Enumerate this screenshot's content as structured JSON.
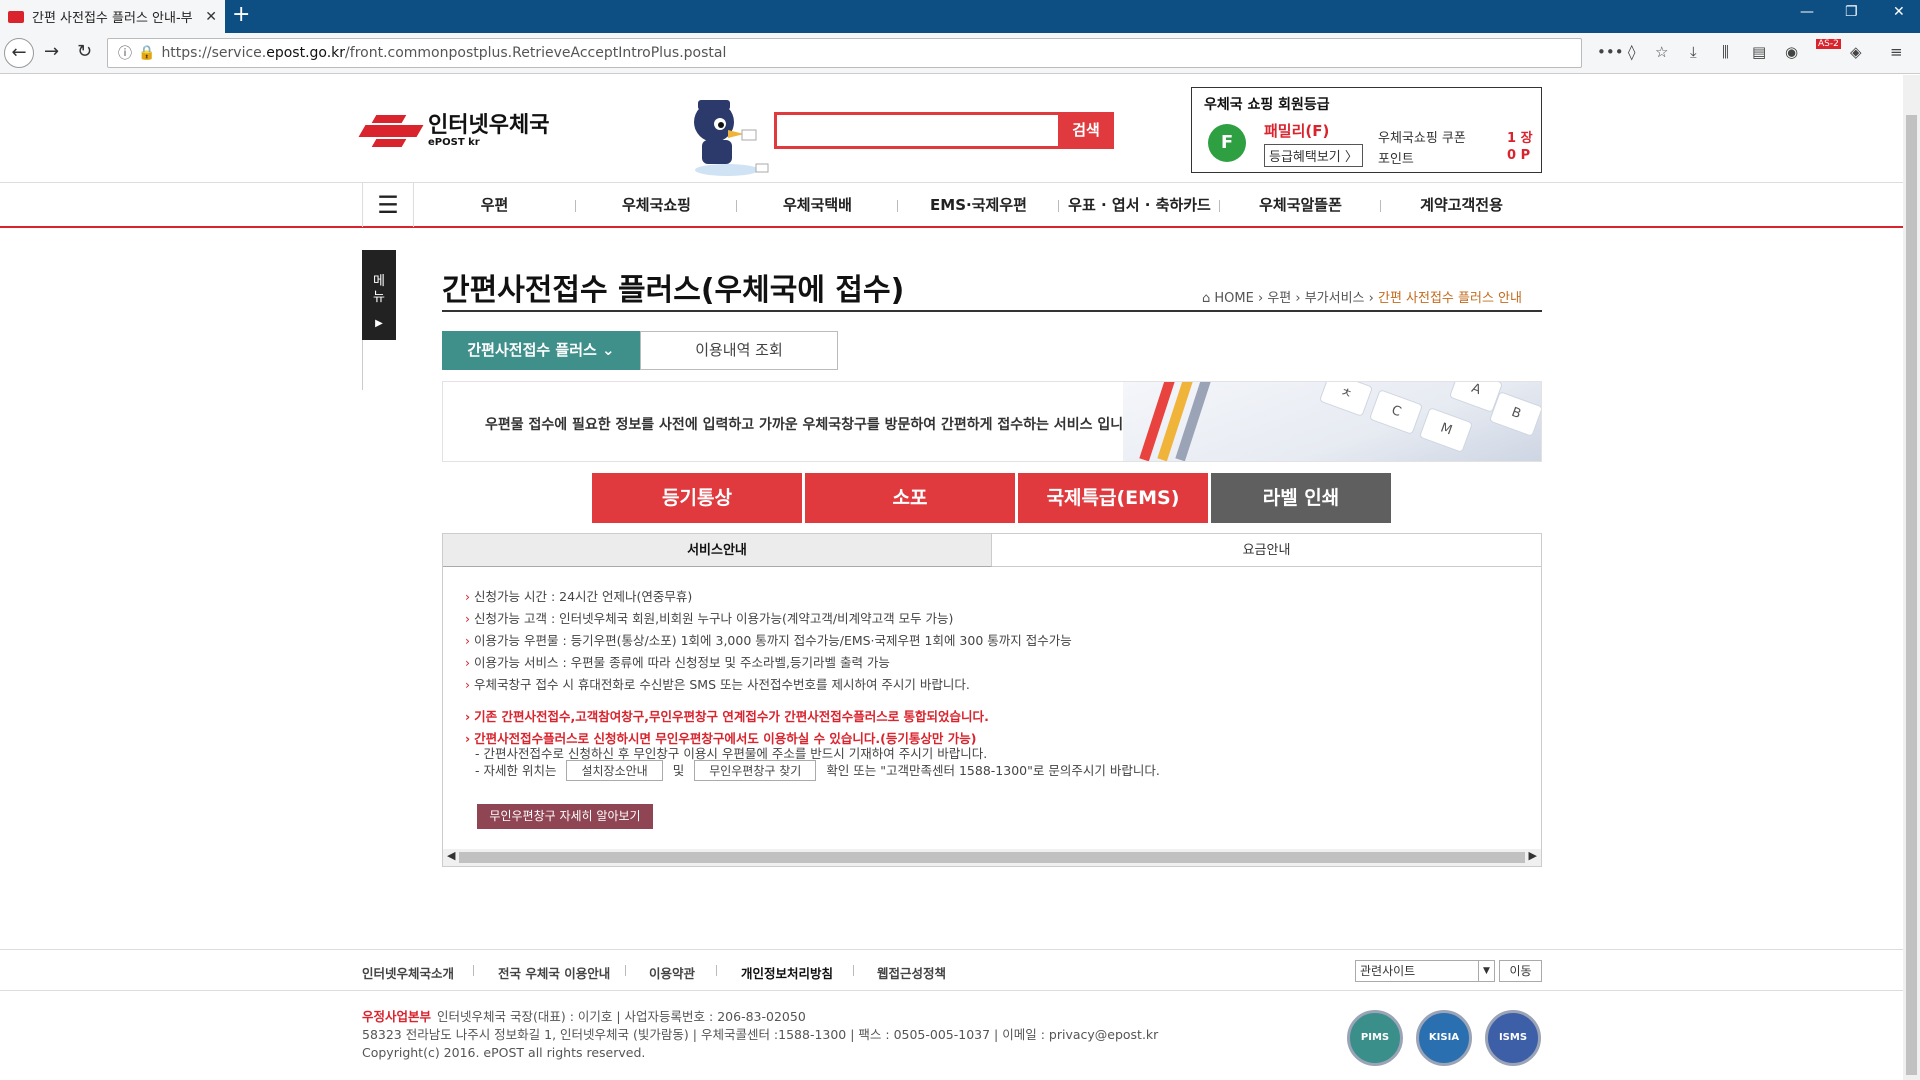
{
  "browser": {
    "tab_title": "간편 사전접수 플러스 안내-부",
    "url_prefix": "https://service.",
    "url_host": "epost.go.kr",
    "url_path": "/front.commonpostplus.RetrieveAcceptIntroPlus.postal",
    "badge": "AS-2"
  },
  "header": {
    "logo_name": "인터넷우체국",
    "logo_sub": "ePOST kr",
    "search_placeholder": "",
    "search_button": "검색",
    "member": {
      "title": "우체국 쇼핑 회원등급",
      "grade_letter": "F",
      "grade_name": "패밀리(F)",
      "benefit_button": "등급혜택보기 〉",
      "coupon_label": "우체국쇼핑 쿠폰",
      "coupon_value": "1 장",
      "point_label": "포인트",
      "point_value": "0 P"
    }
  },
  "gnb": [
    "우편",
    "우체국쇼핑",
    "우체국택배",
    "EMS·국제우편",
    "우표 · 엽서 · 축하카드",
    "우체국알뜰폰",
    "계약고객전용"
  ],
  "side": {
    "label": "메뉴"
  },
  "page": {
    "title": "간편사전접수 플러스(우체국에 접수)",
    "breadcrumb": [
      "HOME",
      "우편",
      "부가서비스",
      "간편 사전접수 플러스 안내"
    ],
    "subtabs": [
      "간편사전접수 플러스",
      "이용내역 조회"
    ],
    "intro": "우편물 접수에 필요한 정보를 사전에 입력하고 가까운 우체국창구를 방문하여 간편하게 접수하는 서비스 입니다.",
    "big_buttons": [
      "등기통상",
      "소포",
      "국제특급(EMS)",
      "라벨 인쇄"
    ],
    "info_tabs": [
      "서비스안내",
      "요금안내"
    ],
    "info_items": [
      "신청가능 시간 : 24시간 언제나(연중무휴)",
      "신청가능 고객 : 인터넷우체국 회원,비회원 누구나 이용가능(계약고객/비계약고객 모두 가능)",
      "이용가능 우편물 : 등기우편(통상/소포) 1회에 3,000 통까지 접수가능/EMS·국제우편 1회에 300 통까지 접수가능",
      "이용가능 서비스 : 우편물 종류에 따라 신청정보 및 주소라벨,등기라벨 출력 가능",
      "우체국창구 접수 시 휴대전화로 수신받은 SMS 또는 사전접수번호를 제시하여 주시기 바랍니다."
    ],
    "info_red": [
      "기존 간편사전접수,고객참여창구,무인우편창구 연계접수가 간편사전접수플러스로 통합되었습니다.",
      "간편사전접수플러스로 신청하시면 무인우편창구에서도 이용하실 수 있습니다.(등기통상만 가능)"
    ],
    "note1": "- 간편사전접수로 신청하신 후 무인창구 이용시 우편물에 주소를 반드시 기재하여 주시기 바랍니다.",
    "note2_a": "- 자세한 위치는",
    "note2_btn1": "설치장소안내",
    "note2_and": "및",
    "note2_btn2": "무인우편창구 찾기",
    "note2_b": "확인 또는 \"고객만족센터 1588-1300\"로 문의주시기 바랍니다.",
    "more_button": "무인우편창구 자세히 알아보기"
  },
  "footer": {
    "links": [
      "인터넷우체국소개",
      "전국 우체국 이용안내",
      "이용약관",
      "개인정보처리방침",
      "웹접근성정책"
    ],
    "select_label": "관련사이트",
    "go_button": "이동",
    "org": "우정사업본부",
    "line1": "인터넷우체국 국장(대표) : 이기호   |   사업자등록번호 : 206-83-02050",
    "line2": "58323 전라남도 나주시 정보화길 1, 인터넷우체국 (빛가람동)   |   우체국콜센터 :1588-1300   |   팩스 : 0505-005-1037   |   이메일 : privacy@epost.kr",
    "line3": "Copyright(c) 2016. ePOST all rights reserved.",
    "certs": [
      "PIMS",
      "KISIA",
      "ISMS"
    ]
  },
  "colors": {
    "brand_red": "#d9232d",
    "teal": "#3f8f8b",
    "gray_button": "#5f5f5f"
  }
}
